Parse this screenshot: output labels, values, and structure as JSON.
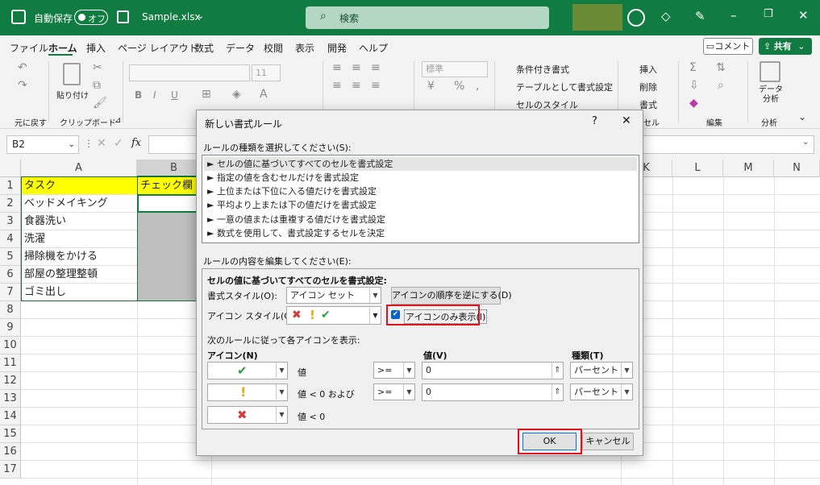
{
  "titlebar": {
    "autosave_label": "自動保存",
    "autosave_state": "オフ",
    "file_name": "Sample.xlsx",
    "search_placeholder": "検索"
  },
  "menu": {
    "tabs": [
      "ファイル",
      "ホーム",
      "挿入",
      "ページ レイアウト",
      "数式",
      "データ",
      "校閲",
      "表示",
      "開発",
      "ヘルプ"
    ],
    "comment_button": "コメント",
    "share_button": "共有"
  },
  "ribbon": {
    "undo_group": "元に戻す",
    "paste_label": "貼り付け",
    "clipboard_group": "クリップボード",
    "font_size": "11",
    "number_format": "標準",
    "conditional_format": "条件付き書式",
    "format_as_table": "テーブルとして書式設定",
    "cell_styles": "セルのスタイル",
    "insert": "挿入",
    "delete": "削除",
    "format": "書式",
    "cells_group": "セル",
    "editing_group": "編集",
    "data_analysis": "データ分析",
    "analysis_group": "分析"
  },
  "formula_bar": {
    "name_box": "B2",
    "fx": "fx"
  },
  "sheet": {
    "col_headers": [
      "A",
      "B",
      "K",
      "L",
      "M",
      "N"
    ],
    "row_numbers": [
      "1",
      "2",
      "3",
      "4",
      "5",
      "6",
      "7",
      "8",
      "9",
      "10",
      "11",
      "12",
      "13",
      "14",
      "15",
      "16",
      "17"
    ],
    "header_a": "タスク",
    "header_b": "チェック欄",
    "tasks": [
      "ベッドメイキング",
      "食器洗い",
      "洗濯",
      "掃除機をかける",
      "部屋の整理整頓",
      "ゴミ出し"
    ]
  },
  "dialog": {
    "title": "新しい書式ルール",
    "help": "?",
    "close": "✕",
    "rule_type_label": "ルールの種類を選択してください(S):",
    "rule_types": [
      "► セルの値に基づいてすべてのセルを書式設定",
      "► 指定の値を含むセルだけを書式設定",
      "► 上位または下位に入る値だけを書式設定",
      "► 平均より上または下の値だけを書式設定",
      "► 一意の値または重複する値だけを書式設定",
      "► 数式を使用して、書式設定するセルを決定"
    ],
    "edit_label": "ルールの内容を編集してください(E):",
    "section_title": "セルの値に基づいてすべてのセルを書式設定:",
    "format_style_label": "書式スタイル(O):",
    "format_style_value": "アイコン セット",
    "reverse_button": "アイコンの順序を逆にする(D)",
    "icon_style_label": "アイコン スタイル(C):",
    "icon_only_label": "アイコンのみ表示(I)",
    "rules_caption": "次のルールに従って各アイコンを表示:",
    "col_icon": "アイコン(N)",
    "col_value": "値(V)",
    "col_type": "種類(T)",
    "rows": [
      {
        "icon": "✔",
        "color": "#2e9e47",
        "cond": "値",
        "op": ">=",
        "value": "0",
        "type": "パーセント"
      },
      {
        "icon": "!",
        "color": "#f0a810",
        "cond": "値 < 0 および",
        "op": ">=",
        "value": "0",
        "type": "パーセント"
      },
      {
        "icon": "✖",
        "color": "#d9373a",
        "cond": "値 < 0",
        "op": "",
        "value": "",
        "type": ""
      }
    ],
    "ok_button": "OK",
    "cancel_button": "キャンセル"
  },
  "colors": {
    "excel_green": "#107c41",
    "header_yellow": "#ffff00",
    "highlight_red": "#e0121b",
    "selected_gray": "#bfbfbf"
  }
}
